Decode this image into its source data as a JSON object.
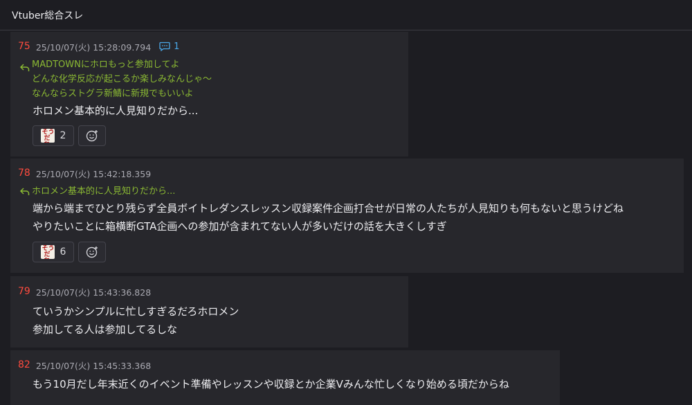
{
  "header": {
    "title": "Vtuber総合スレ"
  },
  "posts": [
    {
      "number": "75",
      "date": "25/10/07(火) 15:28:09.794",
      "reply_count": "1",
      "quote": [
        "MADTOWNにホロもっと参加してよ",
        "どんな化学反応が起こるか楽しみなんじゃ〜",
        "なんならストグラ新鯖に新規でもいいよ"
      ],
      "body": [
        "ホロメン基本的に人見知りだから..."
      ],
      "reaction": {
        "stamp": "そうだね",
        "count": "2"
      }
    },
    {
      "number": "78",
      "date": "25/10/07(火) 15:42:18.359",
      "quote": [
        "ホロメン基本的に人見知りだから..."
      ],
      "body": [
        "端から端までひとり残らず全員ボイトレダンスレッスン収録案件企画打合せが日常の人たちが人見知りも何もないと思うけどね",
        "やりたいことに箱横断GTA企画への参加が含まれてない人が多いだけの話を大きくしすぎ"
      ],
      "reaction": {
        "stamp": "そうだね",
        "count": "6"
      }
    },
    {
      "number": "79",
      "date": "25/10/07(火) 15:43:36.828",
      "body": [
        "ていうかシンプルに忙しすぎるだろホロメン",
        "参加してる人は参加してるしな"
      ]
    },
    {
      "number": "82",
      "date": "25/10/07(火) 15:45:33.368",
      "body": [
        "もう10月だし年末近くのイベント準備やレッスンや収録とか企業Vみんな忙しくなり始める頃だからね"
      ]
    }
  ]
}
